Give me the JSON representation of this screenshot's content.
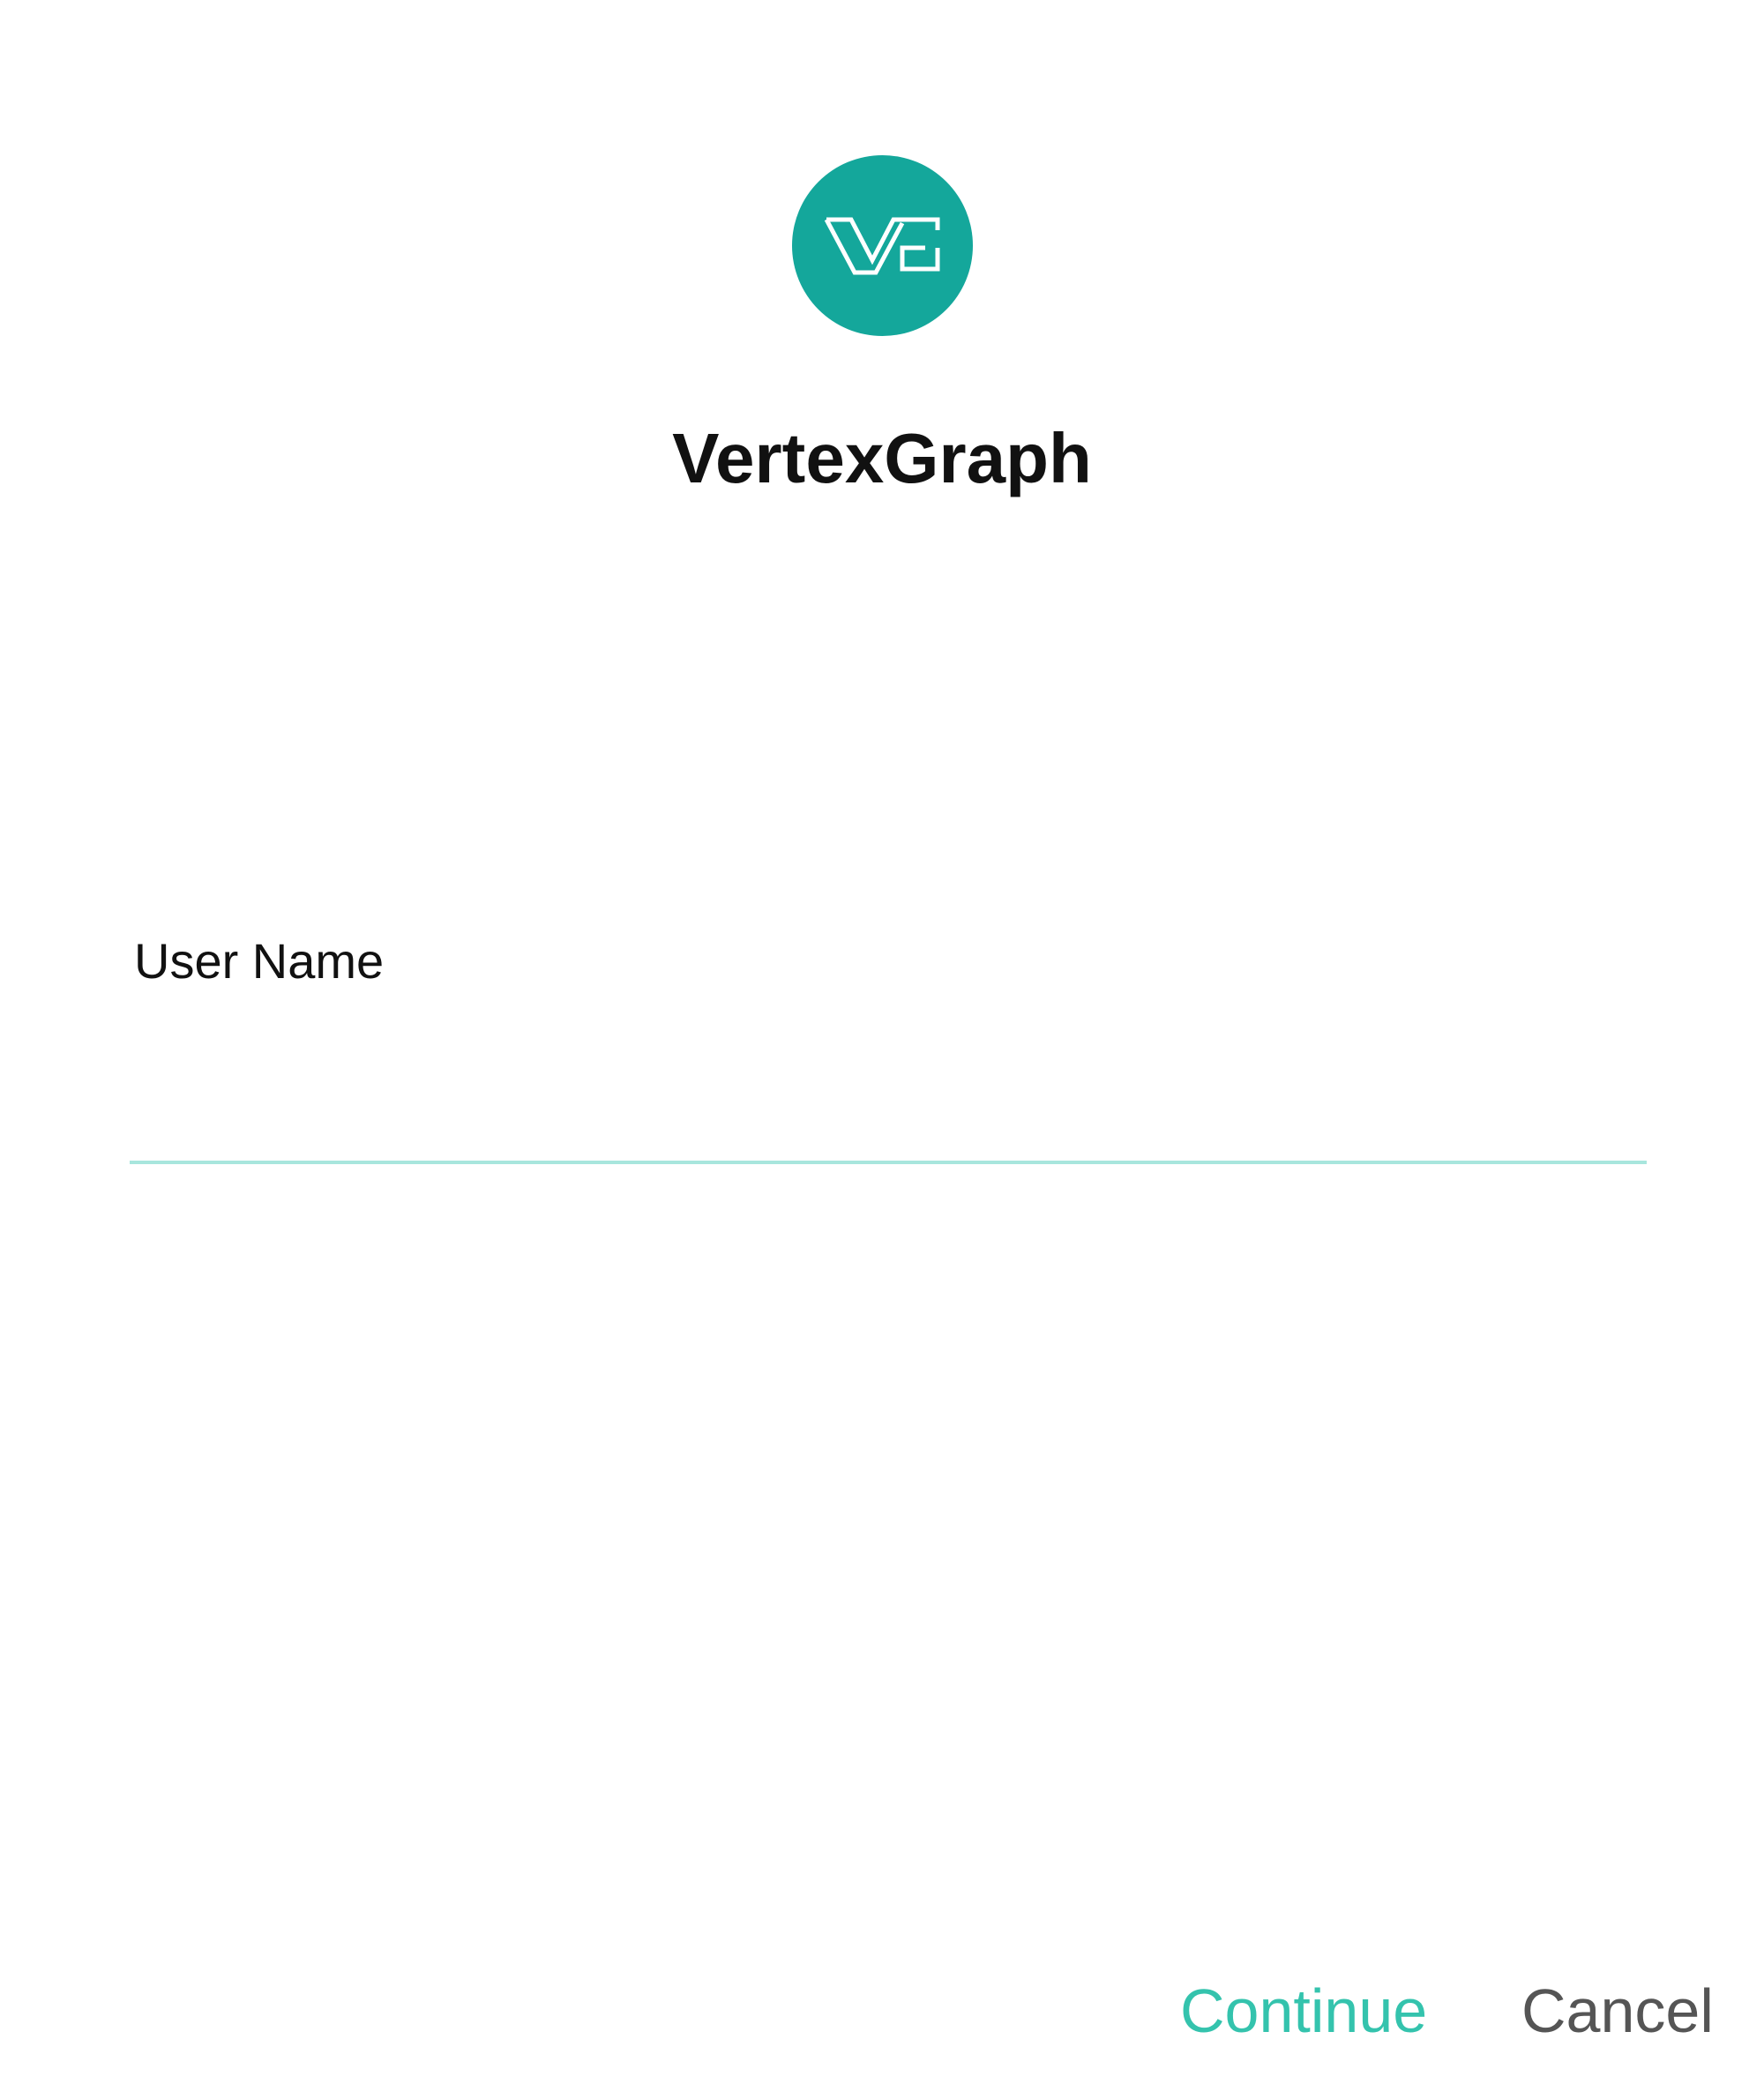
{
  "app": {
    "title": "VertexGraph",
    "logo_icon": "vg-logo-icon",
    "brand_color": "#14a79b"
  },
  "form": {
    "username_label": "User Name",
    "username_value": "",
    "underline_color": "#a8e6dd"
  },
  "actions": {
    "continue_label": "Continue",
    "continue_color": "#34c3ad",
    "cancel_label": "Cancel",
    "cancel_color": "#555555"
  }
}
